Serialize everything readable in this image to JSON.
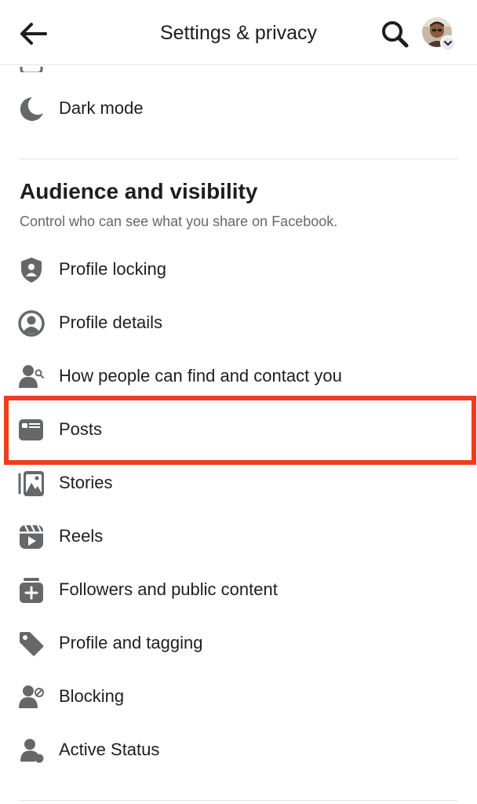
{
  "header": {
    "title": "Settings & privacy",
    "back_icon": "arrow-left-icon",
    "search_icon": "search-icon"
  },
  "preferences": {
    "dark_mode_label": "Dark mode"
  },
  "audience": {
    "title": "Audience and visibility",
    "subtitle": "Control who can see what you share on Facebook.",
    "items": [
      {
        "label": "Profile locking",
        "icon": "shield-person-icon"
      },
      {
        "label": "Profile details",
        "icon": "user-circle-icon"
      },
      {
        "label": "How people can find and contact you",
        "icon": "person-search-icon"
      },
      {
        "label": "Posts",
        "icon": "post-card-icon"
      },
      {
        "label": "Stories",
        "icon": "stories-icon"
      },
      {
        "label": "Reels",
        "icon": "reels-icon"
      },
      {
        "label": "Followers and public content",
        "icon": "followers-add-icon"
      },
      {
        "label": "Profile and tagging",
        "icon": "tag-icon"
      },
      {
        "label": "Blocking",
        "icon": "person-blocked-icon"
      },
      {
        "label": "Active Status",
        "icon": "person-active-icon"
      }
    ]
  },
  "colors": {
    "icon": "#65676b",
    "text": "#1c1e21",
    "secondary_text": "#65676b",
    "divider": "#e4e6eb",
    "highlight": "#f03c1e"
  }
}
